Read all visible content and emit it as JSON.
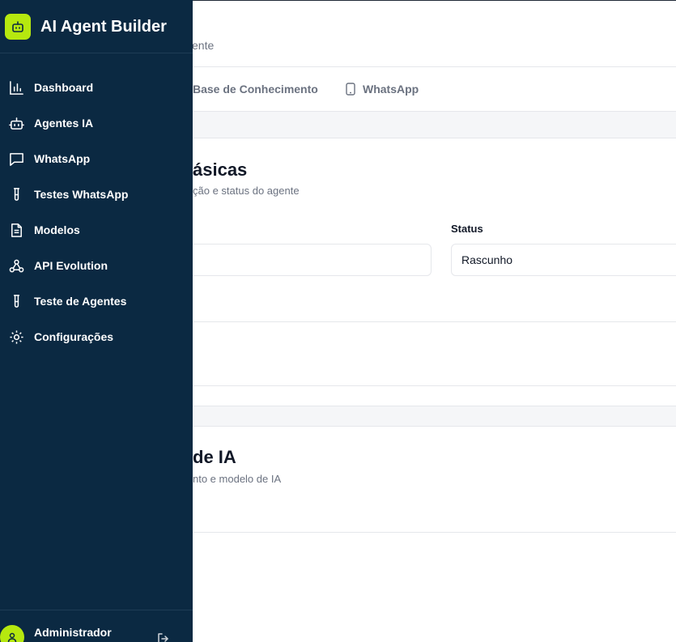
{
  "header": {
    "subtitle_partial": "ente"
  },
  "tabs": [
    {
      "label": "Base de Conhecimento",
      "icon": "book-icon"
    },
    {
      "label": "WhatsApp",
      "icon": "smartphone-icon"
    }
  ],
  "card_basic": {
    "title_partial": "ásicas",
    "desc_partial": "ção e status do agente",
    "status_label": "Status",
    "status_value": "Rascunho"
  },
  "card_ai": {
    "title_partial": "de IA",
    "desc_partial": "nto e modelo de IA"
  },
  "sidebar": {
    "brand": "AI Agent Builder",
    "accent": "#b6e80f",
    "background": "#0b2942",
    "items": [
      {
        "label": "Dashboard",
        "icon": "bar-chart-icon"
      },
      {
        "label": "Agentes IA",
        "icon": "bot-icon"
      },
      {
        "label": "WhatsApp",
        "icon": "message-square-icon"
      },
      {
        "label": "Testes WhatsApp",
        "icon": "test-tube-icon"
      },
      {
        "label": "Modelos",
        "icon": "file-text-icon"
      },
      {
        "label": "API Evolution",
        "icon": "webhook-icon"
      },
      {
        "label": "Teste de Agentes",
        "icon": "test-tube-icon"
      },
      {
        "label": "Configurações",
        "icon": "settings-icon"
      }
    ],
    "user": {
      "name": "Administrador"
    }
  }
}
